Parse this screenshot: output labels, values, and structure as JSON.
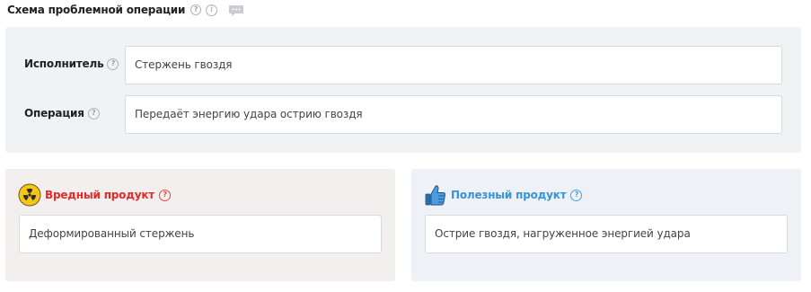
{
  "header": {
    "title": "Схема проблемной операции",
    "help_icon": "question-icon",
    "info_icon": "info-icon",
    "chat_icon": "chat-bubble-icon"
  },
  "operation": {
    "performer_label": "Исполнитель",
    "performer_value": "Стержень гвоздя",
    "operation_label": "Операция",
    "operation_value": "Передаёт энергию удара острию гвоздя"
  },
  "harmful": {
    "title": "Вредный продукт",
    "icon": "radiation-icon",
    "value": "Деформированный стержень",
    "color": "#e02b2b"
  },
  "useful": {
    "title": "Полезный продукт",
    "icon": "thumbs-up-icon",
    "value": "Острие гвоздя, нагруженное энергией удара",
    "color": "#3a92d8"
  },
  "help_glyph": "?",
  "info_glyph": "i"
}
